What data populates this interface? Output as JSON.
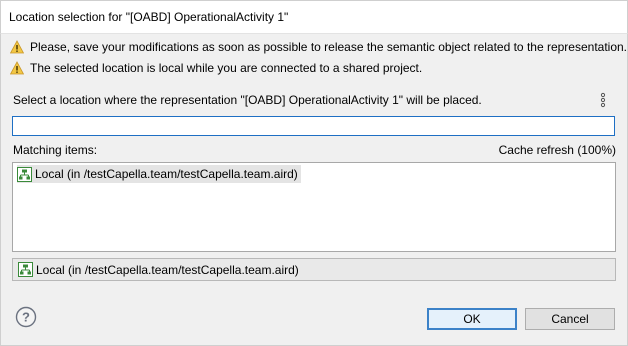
{
  "window": {
    "title": "Location selection for \"[OABD] OperationalActivity 1\""
  },
  "warnings": [
    {
      "icon": "warning-icon",
      "text": "Please, save your modifications as soon as possible to release the semantic object related to the representation."
    },
    {
      "icon": "warning-icon",
      "text": "The selected location is local while you are connected to a shared project."
    }
  ],
  "prompt": "Select a location where the representation \"[OABD] OperationalActivity 1\" will be placed.",
  "search": {
    "value": "",
    "placeholder": ""
  },
  "matching_label": "Matching items:",
  "cache_status": "Cache refresh (100%)",
  "items": [
    {
      "icon": "resource-tree-icon",
      "label": "Local (in /testCapella.team/testCapella.team.aird)"
    }
  ],
  "detail": {
    "icon": "resource-tree-icon",
    "label": "Local (in /testCapella.team/testCapella.team.aird)"
  },
  "buttons": {
    "ok": "OK",
    "cancel": "Cancel"
  },
  "colors": {
    "warning": "#e8b93c",
    "focus": "#1e6fc4",
    "tree_icon": "#3a8a3a"
  }
}
